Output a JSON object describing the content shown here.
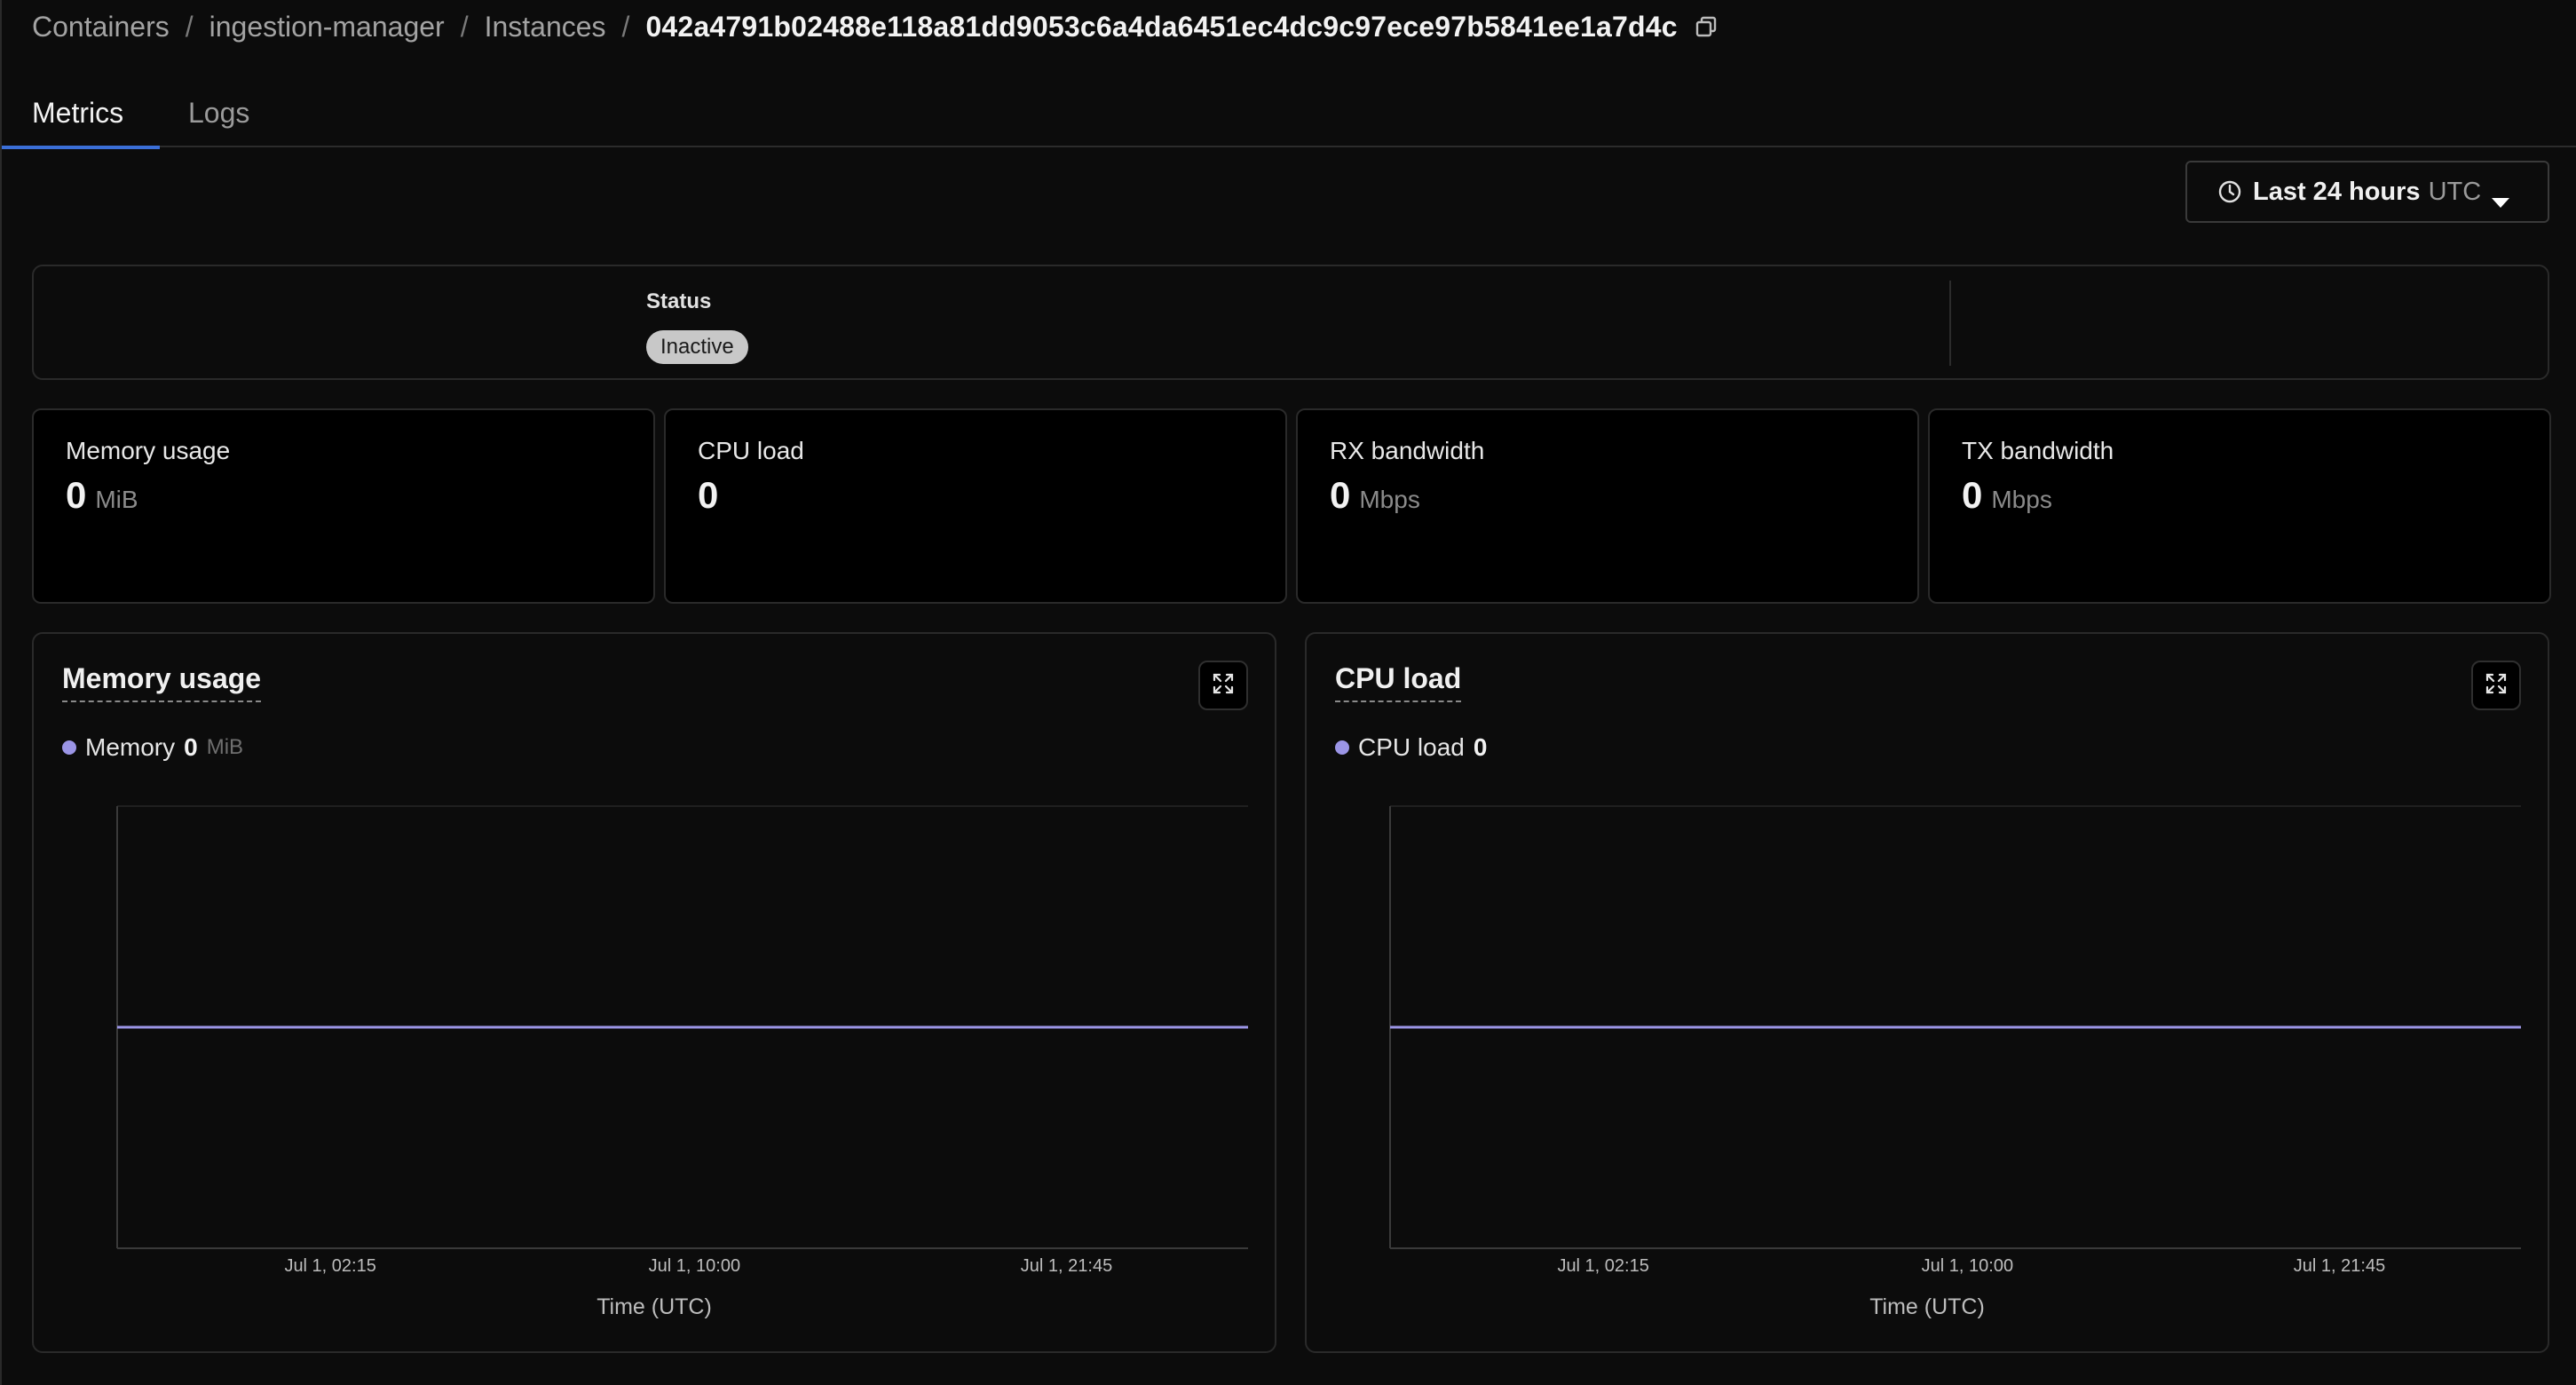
{
  "breadcrumb": {
    "items": [
      "Containers",
      "ingestion-manager",
      "Instances"
    ],
    "separator": "/",
    "current": "042a4791b02488e118a81dd9053c6a4da6451ec4dc9c97ece97b5841ee1a7d4c",
    "copy_icon": "copy-icon"
  },
  "tabs": [
    {
      "label": "Metrics",
      "active": true
    },
    {
      "label": "Logs",
      "active": false
    }
  ],
  "time_range": {
    "label": "Last 24 hours",
    "timezone": "UTC",
    "icon": "clock-icon"
  },
  "status": {
    "label": "Status",
    "value": "Inactive"
  },
  "metrics": [
    {
      "title": "Memory usage",
      "value": "0",
      "unit": "MiB"
    },
    {
      "title": "CPU load",
      "value": "0",
      "unit": ""
    },
    {
      "title": "RX bandwidth",
      "value": "0",
      "unit": "Mbps"
    },
    {
      "title": "TX bandwidth",
      "value": "0",
      "unit": "Mbps"
    }
  ],
  "colors": {
    "accent_tab": "#3b6fd8",
    "series": "#9b95e6",
    "background": "#0c0c0c"
  },
  "chart_data": [
    {
      "type": "line",
      "title": "Memory usage",
      "legend": {
        "name": "Memory",
        "value": "0",
        "unit": "MiB"
      },
      "xlabel": "Time (UTC)",
      "ylabel": "",
      "x_ticks": [
        "Jul 1, 02:15",
        "Jul 1, 10:00",
        "Jul 1, 21:45"
      ],
      "series": [
        {
          "name": "Memory",
          "values": [
            0,
            0
          ]
        }
      ],
      "ylim": [
        -1,
        1
      ],
      "grid": false
    },
    {
      "type": "line",
      "title": "CPU load",
      "legend": {
        "name": "CPU load",
        "value": "0",
        "unit": ""
      },
      "xlabel": "Time (UTC)",
      "ylabel": "",
      "x_ticks": [
        "Jul 1, 02:15",
        "Jul 1, 10:00",
        "Jul 1, 21:45"
      ],
      "series": [
        {
          "name": "CPU load",
          "values": [
            0,
            0
          ]
        }
      ],
      "ylim": [
        -1,
        1
      ],
      "grid": false
    }
  ]
}
